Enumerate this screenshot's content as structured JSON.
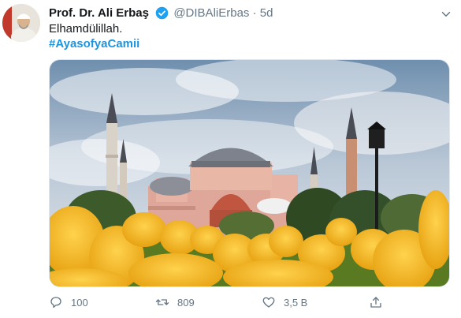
{
  "tweet": {
    "author_name": "Prof. Dr. Ali Erbaş",
    "handle": "@DIBAliErbas",
    "separator": "·",
    "time": "5d",
    "text_line1": "Elhamdülillah.",
    "hashtag": "#AyasofyaCamii"
  },
  "actions": {
    "reply_count": "100",
    "retweet_count": "809",
    "like_count": "3,5 B"
  },
  "icons": {
    "verified": "verified-badge-icon",
    "menu": "chevron-down-icon",
    "reply": "reply-icon",
    "retweet": "retweet-icon",
    "like": "heart-icon",
    "share": "share-icon"
  },
  "colors": {
    "link": "#1b95e0",
    "verified": "#1da1f2",
    "muted": "#657786"
  }
}
